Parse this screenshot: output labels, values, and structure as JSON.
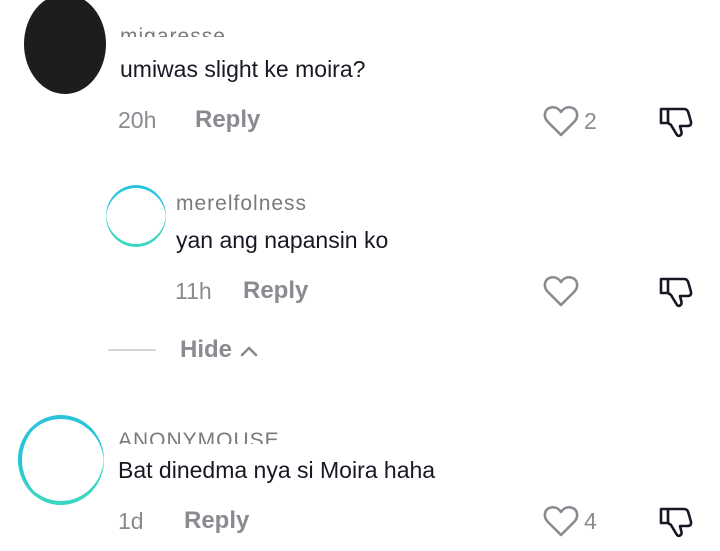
{
  "comments": [
    {
      "username": "migaresse",
      "text": "umiwas slight ke moira?",
      "time": "20h",
      "reply_label": "Reply",
      "like_count": "2"
    },
    {
      "username": "merelfolness",
      "text": "yan ang napansin ko",
      "time": "11h",
      "reply_label": "Reply",
      "like_count": ""
    },
    {
      "username": "ANONYMOUSE",
      "text": "Bat dinedma nya si Moira haha",
      "time": "1d",
      "reply_label": "Reply",
      "like_count": "4"
    }
  ],
  "hide_replies": {
    "label": "Hide"
  },
  "icons": {
    "like": "heart-outline-icon",
    "dislike": "thumbs-down-icon",
    "collapse": "chevron-up-icon"
  },
  "colors": {
    "text": "#161823",
    "muted": "#8a8b91",
    "avatar_ring": "#29c4d9"
  }
}
